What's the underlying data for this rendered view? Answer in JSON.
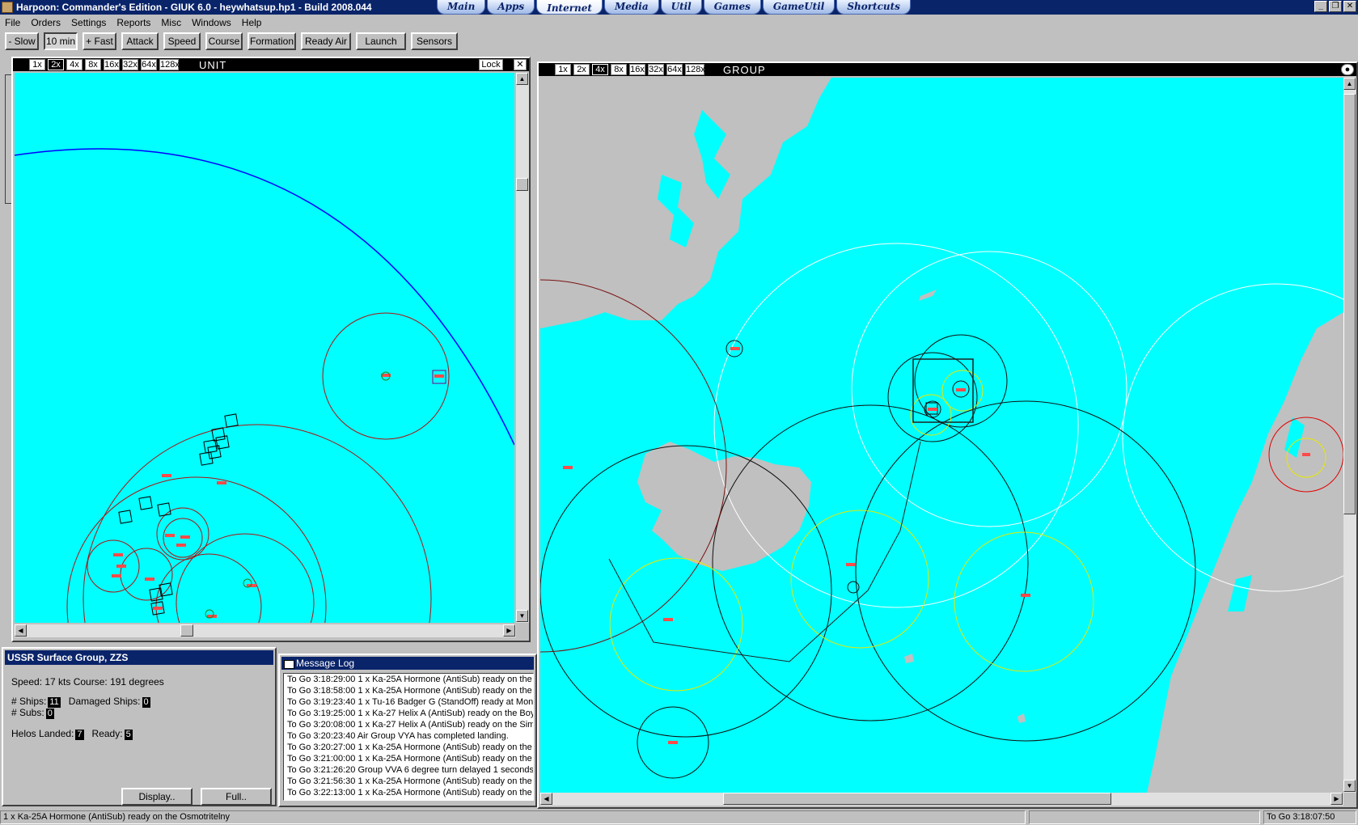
{
  "app": {
    "title": "Harpoon: Commander's Edition - GIUK 6.0 - heywhatsup.hp1 - Build 2008.044",
    "tabs": [
      "Main",
      "Apps",
      "Internet",
      "Media",
      "Util",
      "Games",
      "GameUtil",
      "Shortcuts"
    ],
    "active_tab": "Internet"
  },
  "menu": [
    "File",
    "Orders",
    "Settings",
    "Reports",
    "Misc",
    "Windows",
    "Help"
  ],
  "toolbar": {
    "slow": "- Slow",
    "time": "10 min",
    "fast": "+ Fast",
    "attack": "Attack",
    "speed": "Speed",
    "course": "Course",
    "formation": "Formation",
    "ready_air": "Ready Air",
    "launch": "Launch",
    "sensors": "Sensors"
  },
  "zoom_levels": [
    "1x",
    "2x",
    "4x",
    "8x",
    "16x",
    "32x",
    "64x",
    "128x"
  ],
  "unit_window": {
    "title": "UNIT",
    "selected_zoom": "2x",
    "lock_label": "Lock"
  },
  "group_window": {
    "title": "GROUP",
    "selected_zoom": "4x"
  },
  "info_panel": {
    "title": "USSR Surface Group, ZZS",
    "speed_line": "Speed: 17 kts   Course: 191 degrees",
    "ships_label": "# Ships:",
    "ships": "11",
    "damaged_label": "Damaged Ships:",
    "damaged": "0",
    "subs_label": "# Subs:",
    "subs": "0",
    "helos_label": "Helos Landed:",
    "helos": "7",
    "ready_label": "Ready:",
    "ready": "5",
    "display_btn": "Display..",
    "full_btn": "Full.."
  },
  "message_log": {
    "title": "Message Log",
    "lines": [
      "To Go 3:18:29:00  1 x Ka-25A Hormone (AntiSub) ready on the",
      "To Go 3:18:58:00  1 x Ka-25A Hormone (AntiSub) ready on the",
      "To Go 3:19:23:40  1 x Tu-16 Badger G (StandOff) ready at Mon",
      "To Go 3:19:25:00  1 x Ka-27 Helix A (AntiSub) ready on the Boy",
      "To Go 3:20:08:00  1 x Ka-27 Helix A (AntiSub) ready on the Siml",
      "To Go 3:20:23:40  Air Group VYA has completed landing.",
      "To Go 3:20:27:00  1 x Ka-25A Hormone (AntiSub) ready on the",
      "To Go 3:21:00:00  1 x Ka-25A Hormone (AntiSub) ready on the",
      "To Go 3:21:26:20  Group VVA 6 degree turn delayed 1 seconds;",
      "To Go 3:21:56:30  1 x Ka-25A Hormone (AntiSub) ready on the",
      "To Go 3:22:13:00  1 x Ka-25A Hormone (AntiSub) ready on the"
    ]
  },
  "status": {
    "left": "1 x Ka-25A Hormone (AntiSub) ready on the Osmotritelny",
    "right": "To Go 3:18:07:50"
  },
  "colors": {
    "sea": "#00ffff",
    "land": "#c0c0c0",
    "ship": "#ff4a4a",
    "range_red": "#b01010",
    "range_yellow": "#e8e800",
    "range_white": "#ffffff",
    "range_dark": "#101010",
    "range_blue": "#0000ff"
  }
}
